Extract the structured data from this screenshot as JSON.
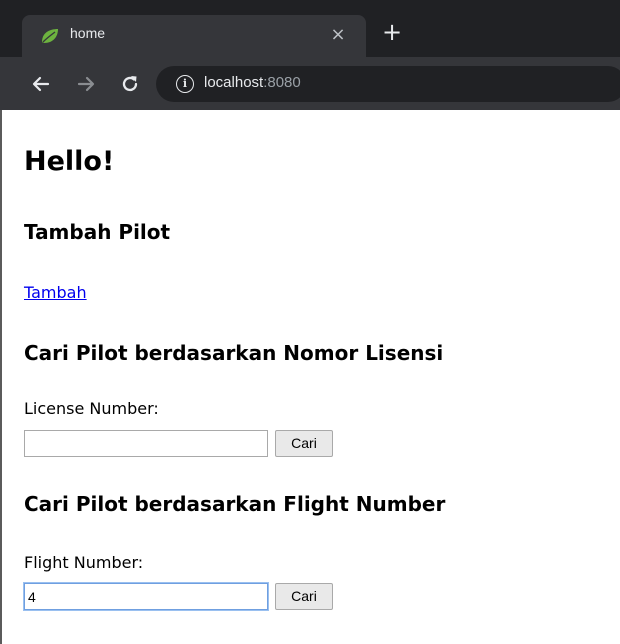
{
  "browser": {
    "tab_title": "home",
    "tab_close_glyph": "×",
    "new_tab_glyph": "+",
    "url_host": "localhost",
    "url_port": ":8080",
    "icons": {
      "favicon": "spring-leaf-icon",
      "back": "arrow-left-icon",
      "forward": "arrow-right-icon",
      "reload": "reload-icon",
      "info": "info-icon"
    },
    "colors": {
      "frame": "#202124",
      "toolbar": "#35363a",
      "favicon": "#6db33f"
    }
  },
  "page": {
    "greeting": "Hello!",
    "add_section_title": "Tambah Pilot",
    "add_link": "Tambah",
    "license_section_title": "Cari Pilot berdasarkan Nomor Lisensi",
    "license_label": "License Number:",
    "license_value": "",
    "license_button": "Cari",
    "flight_section_title": "Cari Pilot berdasarkan Flight Number",
    "flight_label": "Flight Number:",
    "flight_value": "4",
    "flight_button": "Cari",
    "colors": {
      "link": "#0000ee"
    }
  }
}
